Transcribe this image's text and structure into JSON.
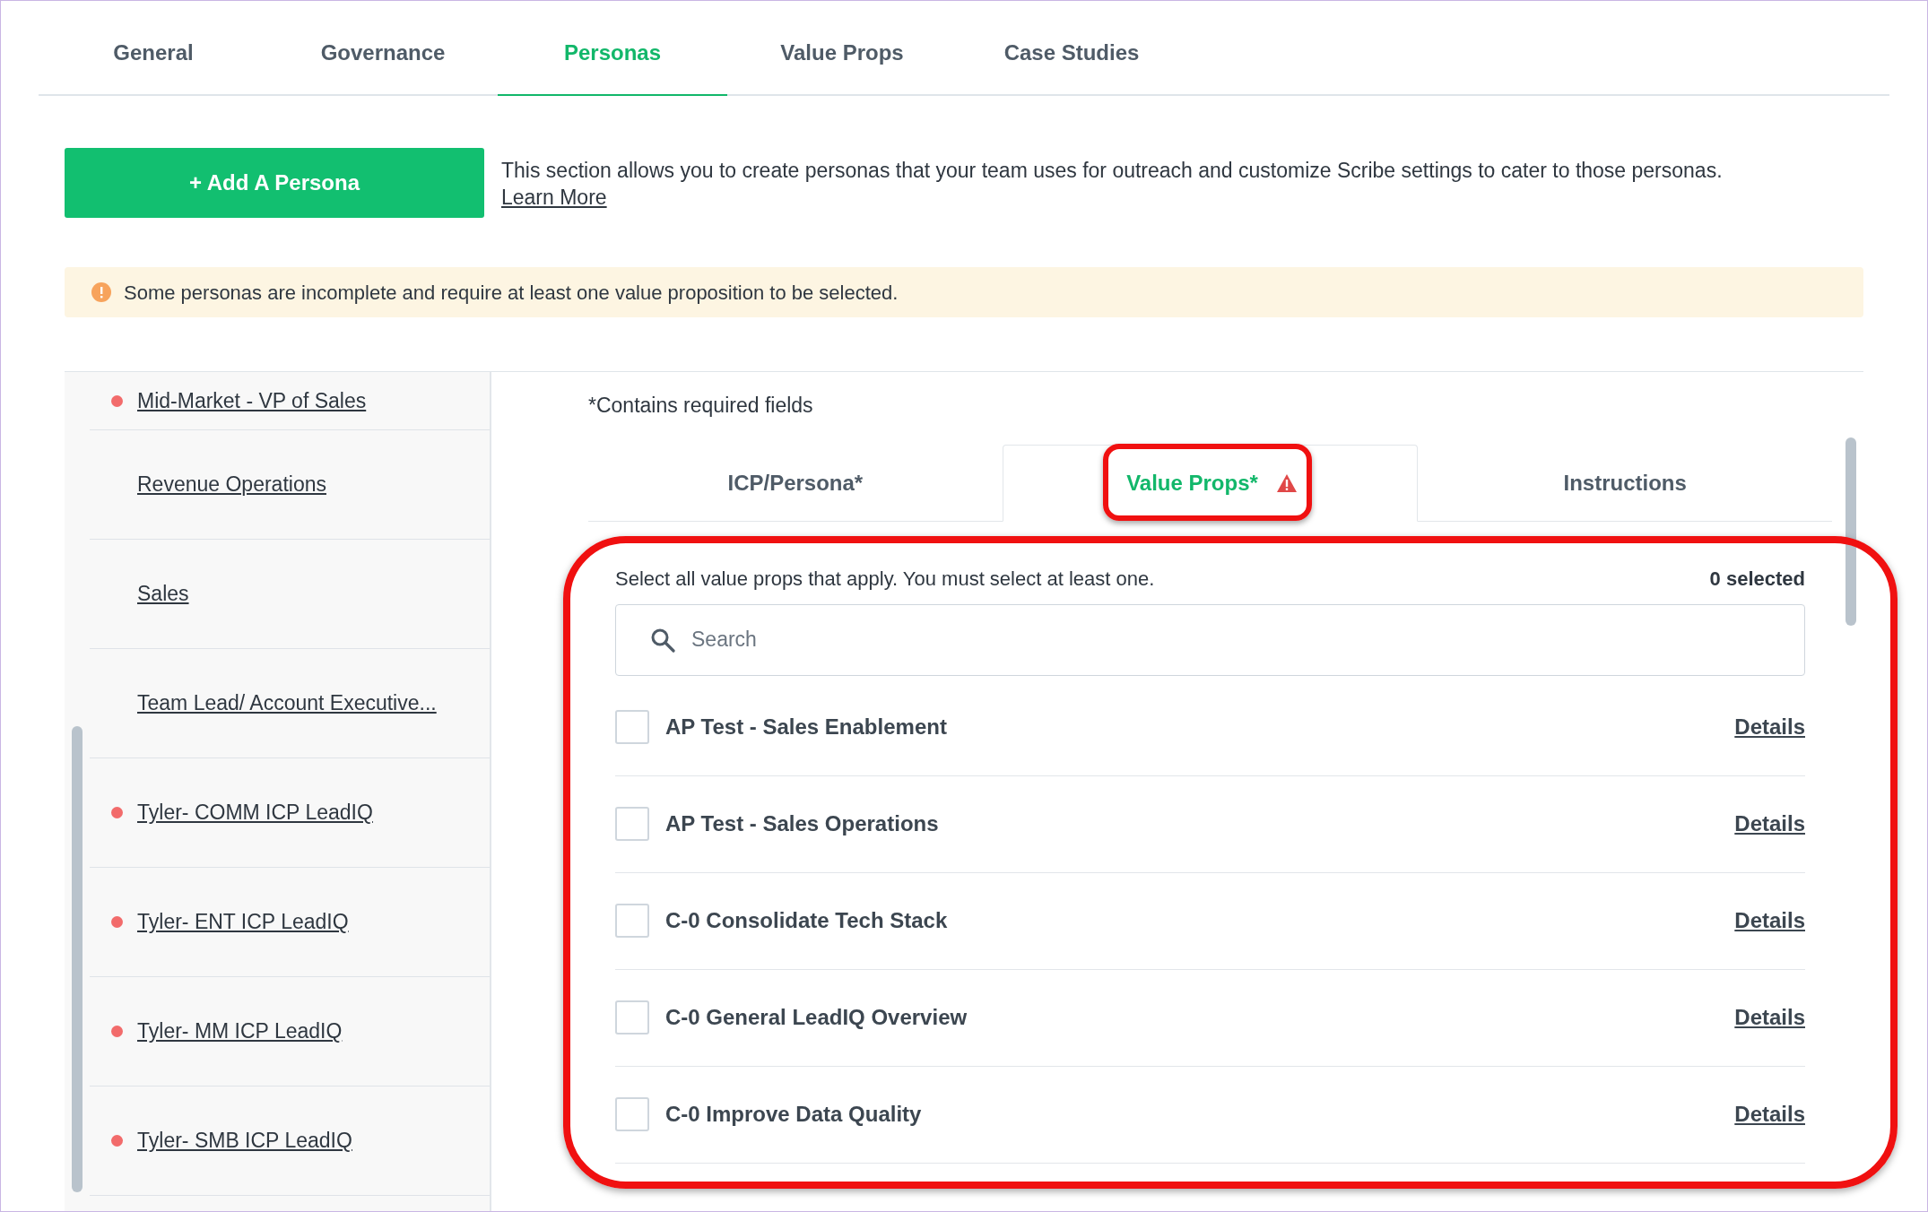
{
  "tabs": [
    {
      "label": "General",
      "selected": false
    },
    {
      "label": "Governance",
      "selected": false
    },
    {
      "label": "Personas",
      "selected": true
    },
    {
      "label": "Value Props",
      "selected": false
    },
    {
      "label": "Case Studies",
      "selected": false
    }
  ],
  "add_button": "+ Add A Persona",
  "description": {
    "text": "This section allows you to create personas that your team uses for outreach and customize Scribe settings to cater to those personas.",
    "link": "Learn More"
  },
  "alert": "Some personas are incomplete and require at least one value proposition to be selected.",
  "personas": [
    {
      "name": "Mid-Market - VP of Sales",
      "incomplete": true
    },
    {
      "name": "Revenue Operations",
      "incomplete": false
    },
    {
      "name": "Sales",
      "incomplete": false
    },
    {
      "name": "Team Lead/ Account Executive...",
      "incomplete": false
    },
    {
      "name": "Tyler- COMM ICP LeadIQ",
      "incomplete": true
    },
    {
      "name": "Tyler- ENT ICP LeadIQ",
      "incomplete": true
    },
    {
      "name": "Tyler- MM ICP LeadIQ",
      "incomplete": true
    },
    {
      "name": "Tyler- SMB ICP LeadIQ",
      "incomplete": true
    }
  ],
  "required_note": "*Contains required fields",
  "subtabs": [
    {
      "label": "ICP/Persona*",
      "selected": false,
      "warning": false
    },
    {
      "label": "Value Props*",
      "selected": true,
      "warning": true
    },
    {
      "label": "Instructions",
      "selected": false,
      "warning": false
    }
  ],
  "instruction": "Select all value props that apply. You must select at least one.",
  "selected_count": "0 selected",
  "search": {
    "placeholder": "Search"
  },
  "value_props": [
    {
      "name": "AP Test - Sales Enablement",
      "checked": false,
      "link": "Details"
    },
    {
      "name": "AP Test - Sales Operations",
      "checked": false,
      "link": "Details"
    },
    {
      "name": "C-0 Consolidate Tech Stack",
      "checked": false,
      "link": "Details"
    },
    {
      "name": "C-0 General LeadIQ Overview",
      "checked": false,
      "link": "Details"
    },
    {
      "name": "C-0 Improve Data Quality",
      "checked": false,
      "link": "Details"
    }
  ]
}
